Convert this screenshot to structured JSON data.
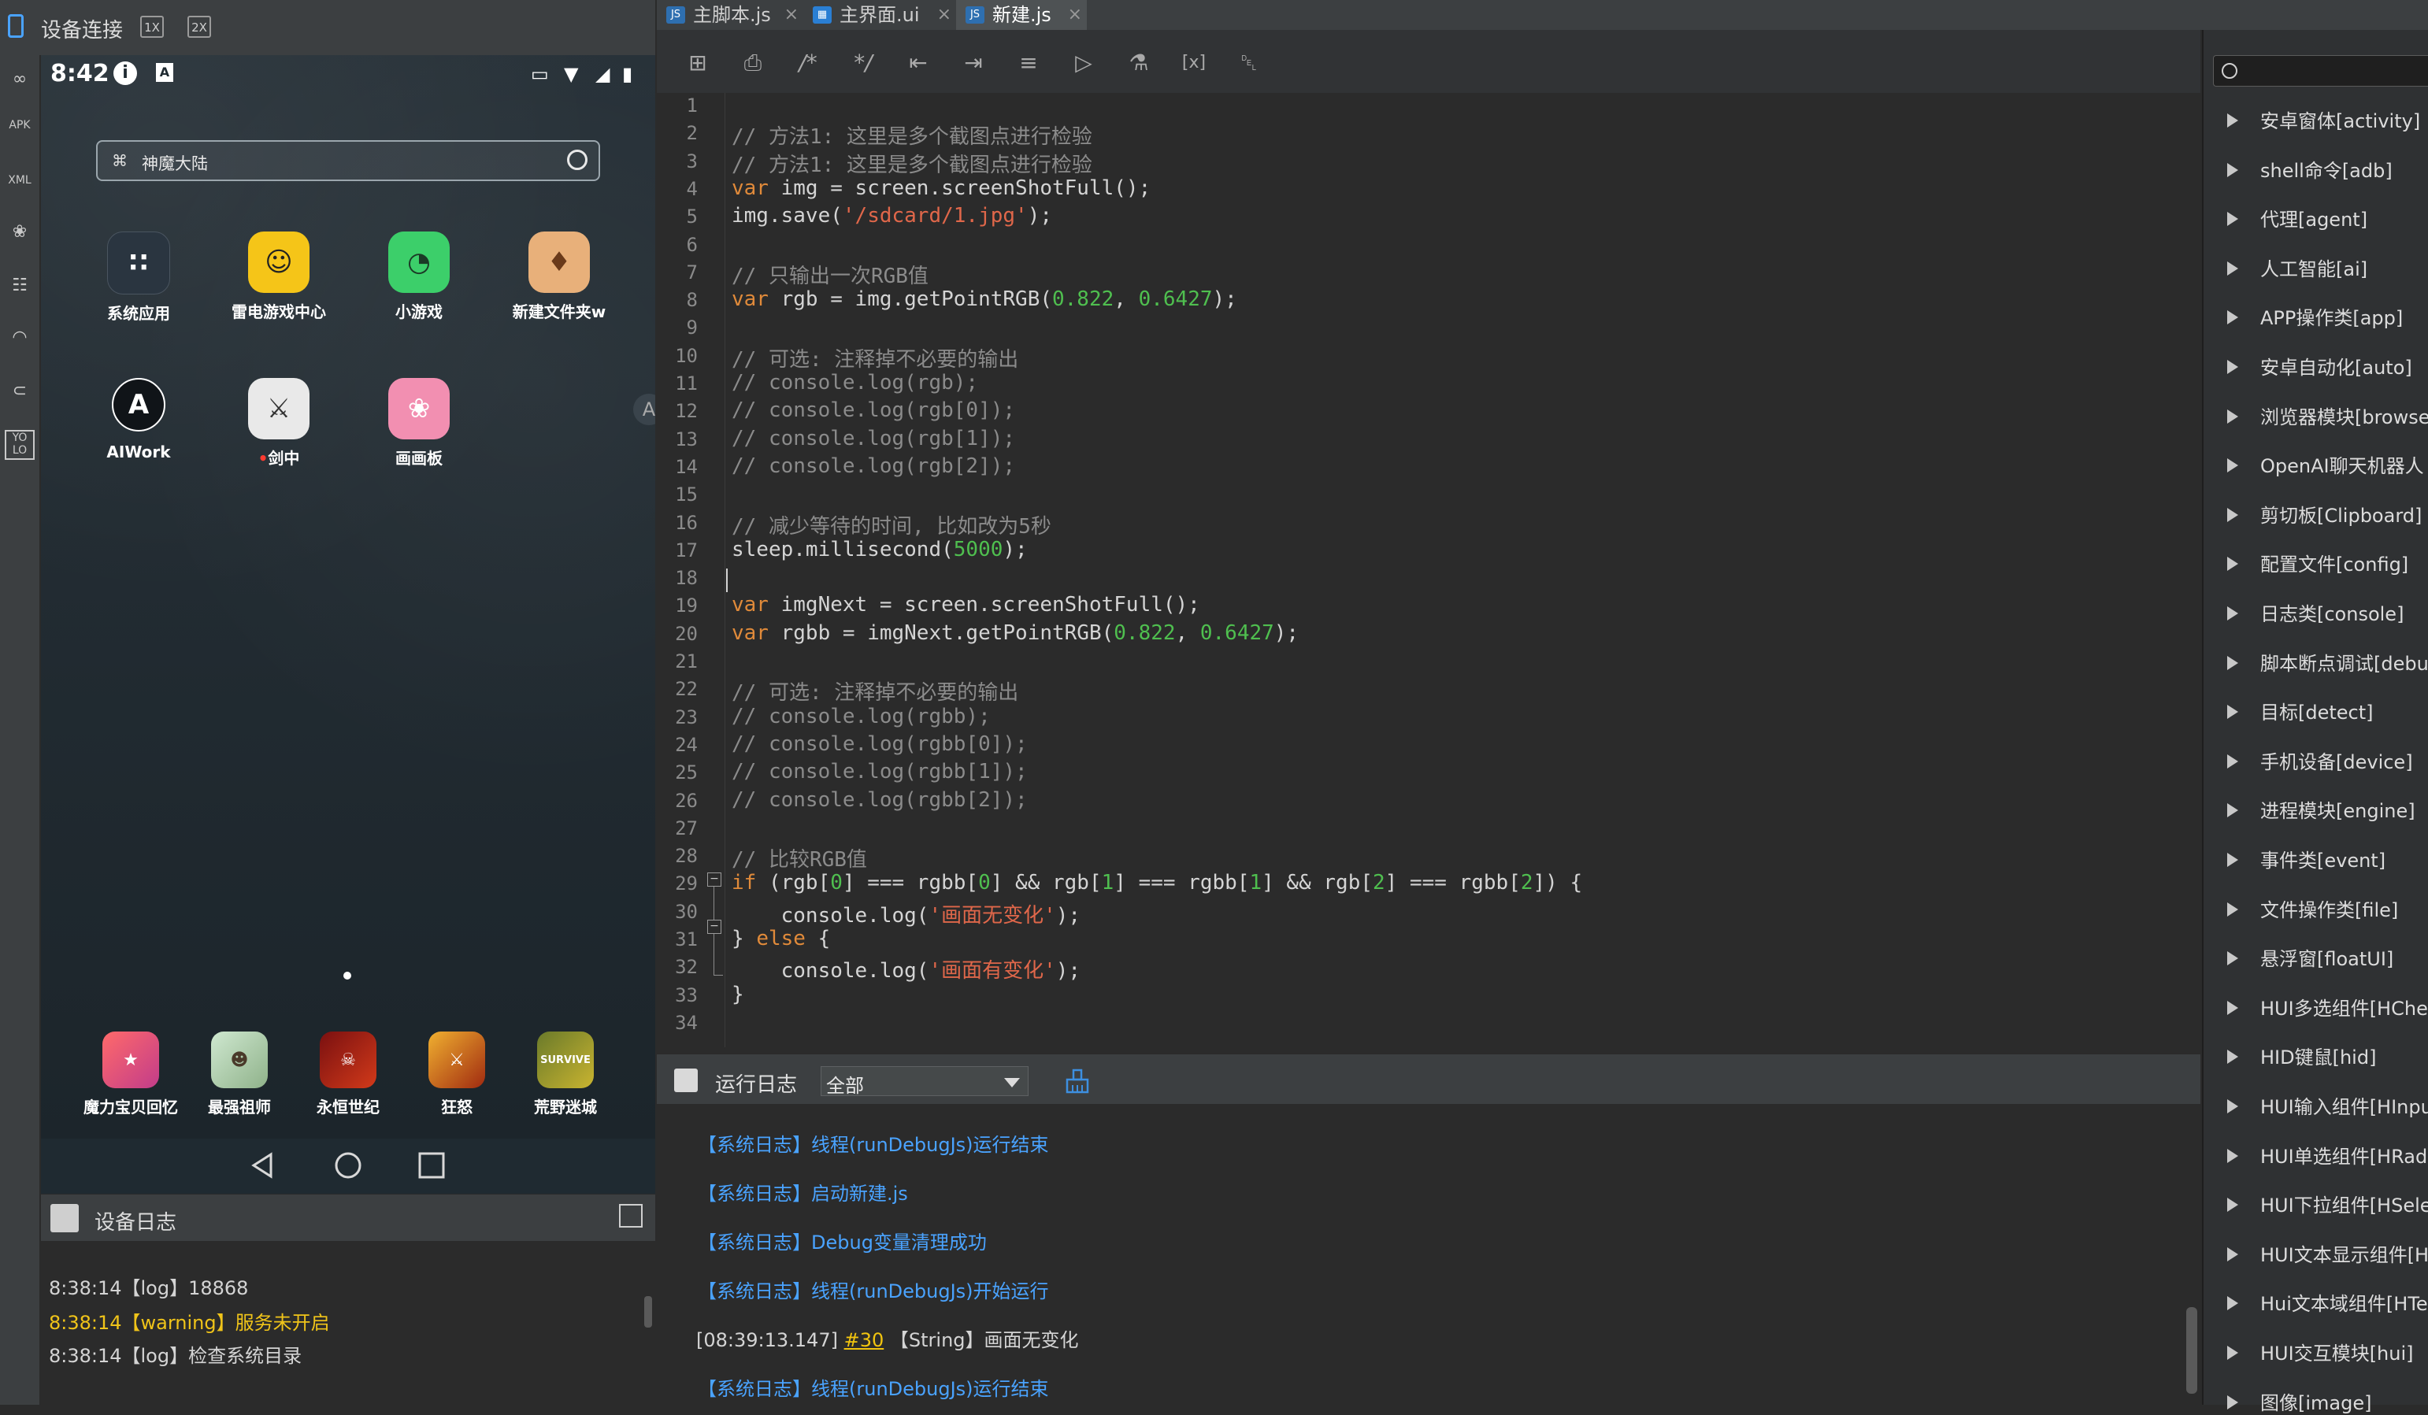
{
  "device_panel": {
    "title": "设备连接",
    "scale_buttons": [
      "1X",
      "2X"
    ]
  },
  "phone": {
    "status": {
      "time": "8:42",
      "info": "i",
      "a": "A"
    },
    "search": {
      "text": "神魔大陆"
    },
    "apps": [
      {
        "label": "系统应用"
      },
      {
        "label": "雷电游戏中心"
      },
      {
        "label": "小游戏"
      },
      {
        "label": "新建文件夹w"
      },
      {
        "label": "AIWork"
      },
      {
        "label": "剑中"
      },
      {
        "label": "画画板"
      }
    ],
    "dock": [
      {
        "label": "魔力宝贝回忆"
      },
      {
        "label": "最强祖师"
      },
      {
        "label": "永恒世纪"
      },
      {
        "label": "狂怒"
      },
      {
        "label": "荒野迷城"
      }
    ],
    "dock_badges": {
      "survive": "SURVIVE"
    }
  },
  "device_log": {
    "title": "设备日志",
    "lines": [
      {
        "text": "8:38:14【log】18868",
        "color": "#d4d4d4"
      },
      {
        "text": "8:38:14【warning】服务未开启",
        "color": "#f0c419"
      },
      {
        "text": "8:38:14【log】检查系统目录",
        "color": "#d4d4d4"
      }
    ]
  },
  "tabs": [
    {
      "label": "主脚本.js",
      "type": "js"
    },
    {
      "label": "主界面.ui",
      "type": "ui"
    },
    {
      "label": "新建.js",
      "type": "js",
      "active": true
    }
  ],
  "code": {
    "line_numbers": [
      "1",
      "2",
      "3",
      "4",
      "5",
      "6",
      "7",
      "8",
      "9",
      "10",
      "11",
      "12",
      "13",
      "14",
      "15",
      "16",
      "17",
      "18",
      "19",
      "20",
      "21",
      "22",
      "23",
      "24",
      "25",
      "26",
      "27",
      "28",
      "29",
      "30",
      "31",
      "32",
      "33",
      "34"
    ],
    "lines": [
      "",
      "// 方法1: 这里是多个截图点进行检验",
      "// 方法1: 这里是多个截图点进行检验",
      "var img = screen.screenShotFull();",
      "img.save('/sdcard/1.jpg');",
      "",
      "// 只输出一次RGB值",
      "var rgb = img.getPointRGB(0.822, 0.6427);",
      "",
      "// 可选: 注释掉不必要的输出",
      "// console.log(rgb);",
      "// console.log(rgb[0]);",
      "// console.log(rgb[1]);",
      "// console.log(rgb[2]);",
      "",
      "// 减少等待的时间, 比如改为5秒",
      "sleep.millisecond(5000);",
      "",
      "var imgNext = screen.screenShotFull();",
      "var rgbb = imgNext.getPointRGB(0.822, 0.6427);",
      "",
      "// 可选: 注释掉不必要的输出",
      "// console.log(rgbb);",
      "// console.log(rgbb[0]);",
      "// console.log(rgbb[1]);",
      "// console.log(rgbb[2]);",
      "",
      "// 比较RGB值",
      "if (rgb[0] === rgbb[0] && rgb[1] === rgbb[1] && rgb[2] === rgbb[2]) {",
      "    console.log('画面无变化');",
      "} else {",
      "    console.log('画面有变化');",
      "}",
      ""
    ]
  },
  "run_log": {
    "title": "运行日志",
    "filter": "全部",
    "lines": [
      {
        "text": "【系统日志】线程(runDebugJs)运行结束",
        "kind": "sys"
      },
      {
        "text": "【系统日志】启动新建.js",
        "kind": "sys"
      },
      {
        "text": "【系统日志】Debug变量清理成功",
        "kind": "sys"
      },
      {
        "text": "【系统日志】线程(runDebugJs)开始运行",
        "kind": "sys"
      },
      {
        "prefix": "[08:39:13.147]",
        "link": "#30",
        "suffix": "【String】画面无变化",
        "kind": "user"
      },
      {
        "text": "【系统日志】线程(runDebugJs)运行结束",
        "kind": "sys"
      }
    ]
  },
  "api_panel": {
    "items": [
      "安卓窗体[activity]",
      "shell命令[adb]",
      "代理[agent]",
      "人工智能[ai]",
      "APP操作类[app]",
      "安卓自动化[auto]",
      "浏览器模块[browse",
      "OpenAI聊天机器人",
      "剪切板[Clipboard]",
      "配置文件[config]",
      "日志类[console]",
      "脚本断点调试[debu",
      "目标[detect]",
      "手机设备[device]",
      "进程模块[engine]",
      "事件类[event]",
      "文件操作类[file]",
      "悬浮窗[floatUI]",
      "HUI多选组件[HChe",
      "HID键鼠[hid]",
      "HUI输入组件[HInpu",
      "HUI单选组件[HRad",
      "HUI下拉组件[HSele",
      "HUI文本显示组件[H",
      "Hui文本域组件[HTe",
      "HUI交互模块[hui]",
      "图像[image]"
    ]
  },
  "colors": {
    "accent": "#4aa3ff",
    "keyword": "#e08a3a",
    "string": "#e0674a",
    "number": "#4fbf4f",
    "comment": "#8b8b8b",
    "warning": "#f0c419"
  }
}
